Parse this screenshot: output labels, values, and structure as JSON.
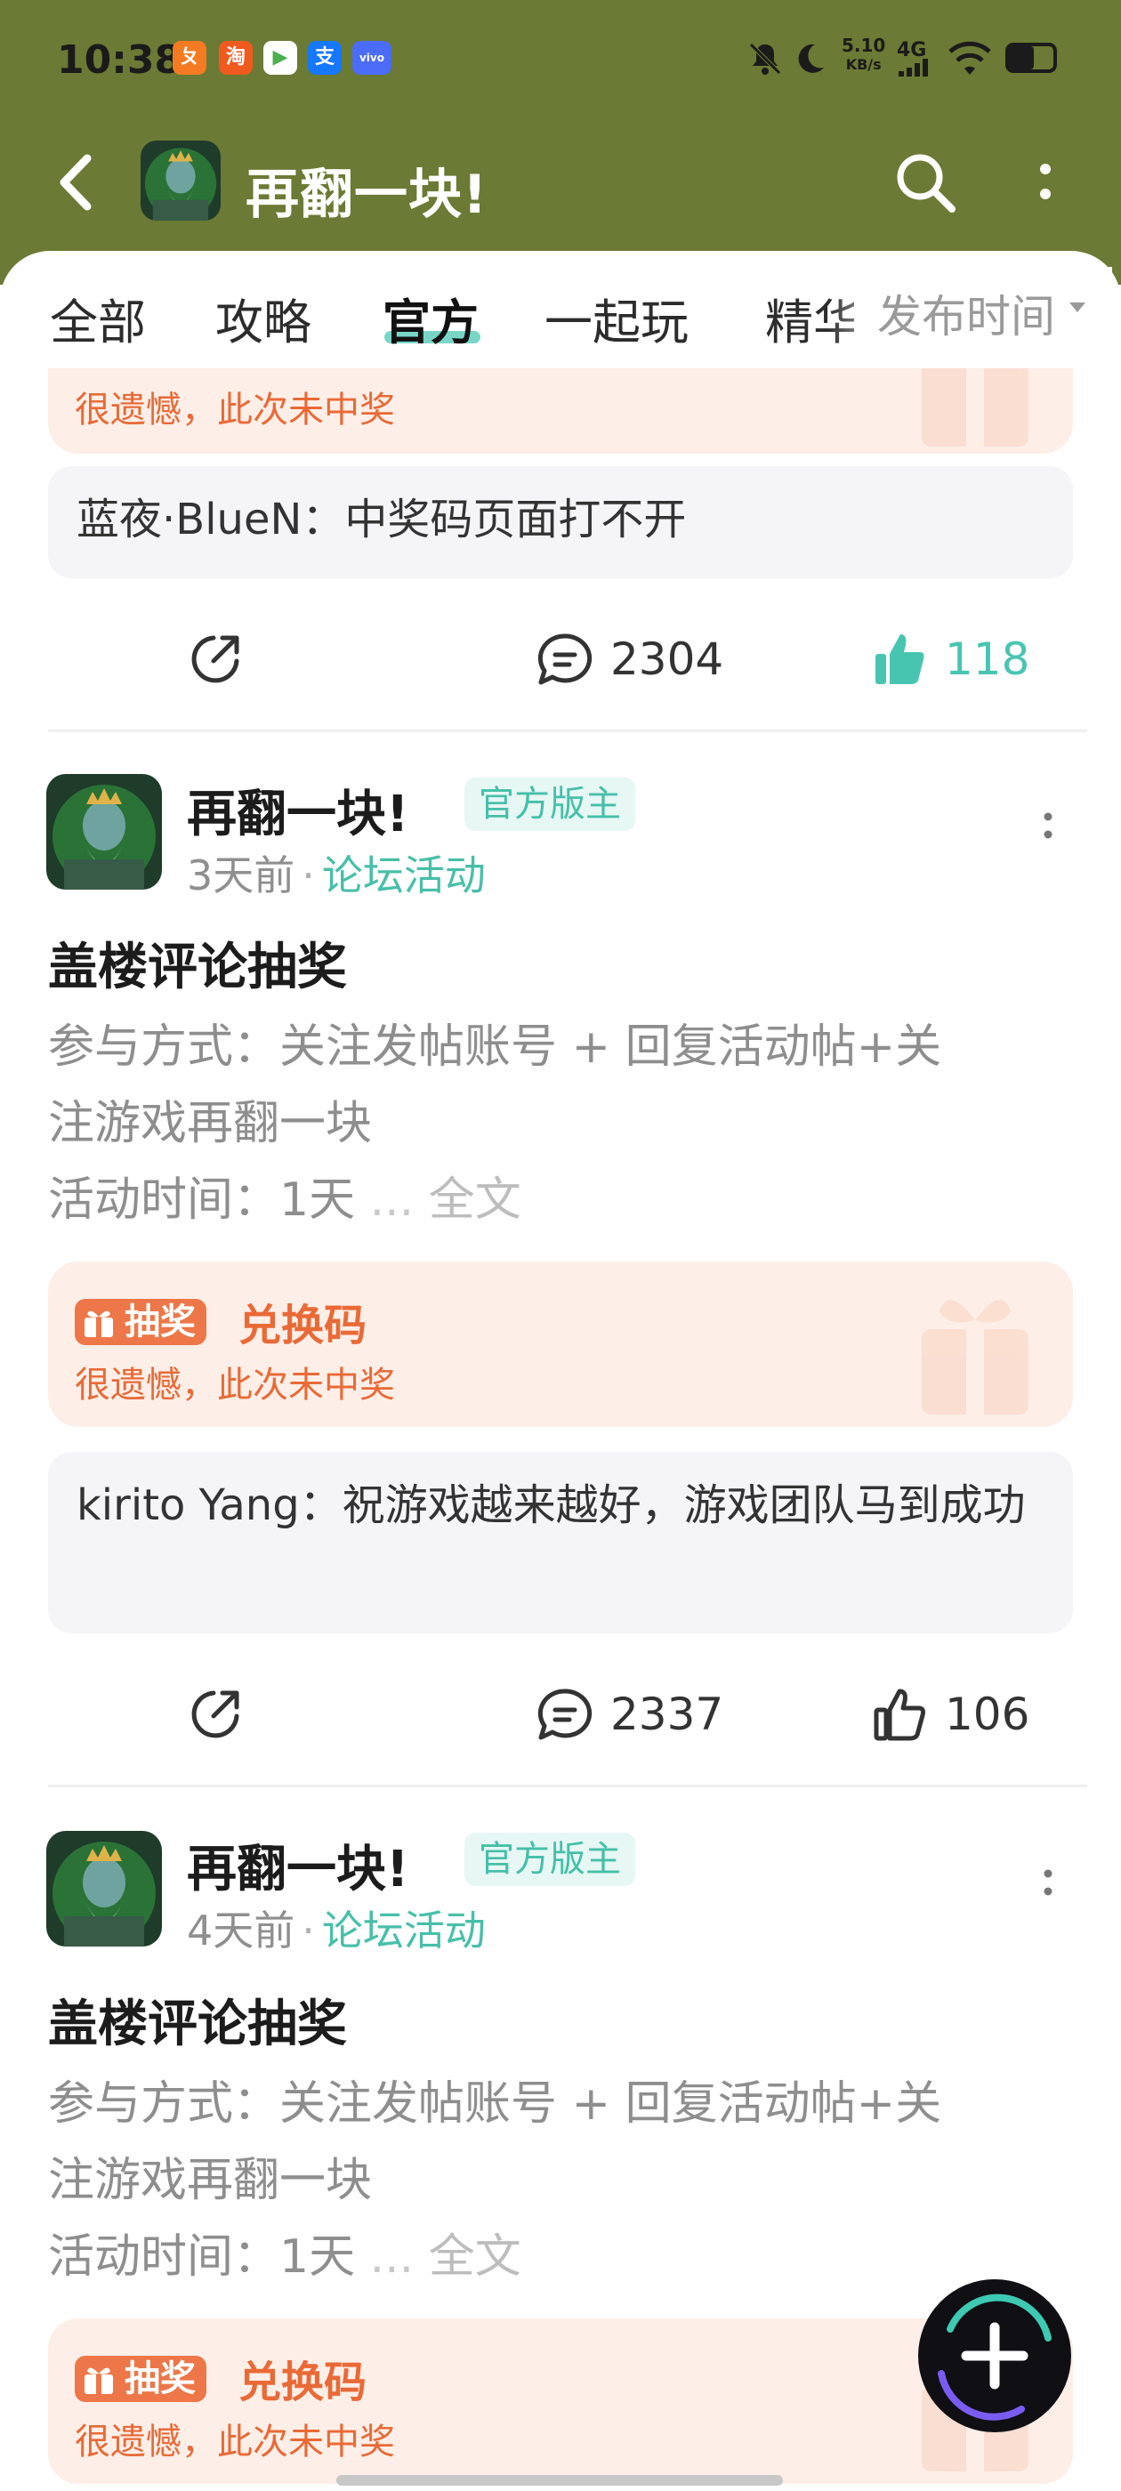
{
  "status_bar": {
    "time": "10:38",
    "apps": [
      {
        "name": "app-1",
        "color": "#f47b22",
        "glyph": "ㄆ"
      },
      {
        "name": "taobao",
        "color": "#f05a1e",
        "glyph": "淘"
      },
      {
        "name": "app-3",
        "color": "#6bbf4a",
        "glyph": "▶"
      },
      {
        "name": "alipay",
        "color": "#1677ff",
        "glyph": "支"
      },
      {
        "name": "vivo",
        "color": "#4a6cf7",
        "glyph": "vivo"
      }
    ],
    "net_speed": "5.10",
    "net_unit": "KB/s",
    "net_type": "4G"
  },
  "header": {
    "title": "再翻一块!",
    "bg_color": "#6b7a34"
  },
  "tabs": {
    "items": [
      "全部",
      "攻略",
      "官方",
      "一起玩",
      "精华"
    ],
    "active_index": 2,
    "sort_label": "发布时间"
  },
  "feed": {
    "partial_top": {
      "lottery_status": "很遗憾，此次未中奖",
      "comment_user": "蓝夜·BlueN",
      "comment_text": "中奖码页面打不开",
      "comment_full": "蓝夜·BlueN：中奖码页面打不开",
      "comments": "2304",
      "likes": "118",
      "liked": true
    },
    "posts": [
      {
        "author": "再翻一块!",
        "badge": "官方版主",
        "time": "3天前",
        "category": "论坛活动",
        "title": "盖楼评论抽奖",
        "body_line1": "参与方式：关注发帖账号 + 回复活动帖+关",
        "body_line2": "注游戏再翻一块",
        "body_line3": "活动时间：1天",
        "ellipsis": "...",
        "full_text_label": "全文",
        "lottery_badge": "抽奖",
        "lottery_title": "兑换码",
        "lottery_status": "很遗憾，此次未中奖",
        "comment_full": "kirito Yang：祝游戏越来越好，游戏团队马到成功",
        "comments": "2337",
        "likes": "106",
        "liked": false
      },
      {
        "author": "再翻一块!",
        "badge": "官方版主",
        "time": "4天前",
        "category": "论坛活动",
        "title": "盖楼评论抽奖",
        "body_line1": "参与方式：关注发帖账号 + 回复活动帖+关",
        "body_line2": "注游戏再翻一块",
        "body_line3": "活动时间：1天",
        "ellipsis": "...",
        "full_text_label": "全文",
        "lottery_badge": "抽奖",
        "lottery_title": "兑换码",
        "lottery_status": "很遗憾，此次未中奖"
      }
    ]
  },
  "colors": {
    "accent": "#48c5b1",
    "lottery": "#e96a37",
    "lottery_bg": "#fdefe8"
  }
}
